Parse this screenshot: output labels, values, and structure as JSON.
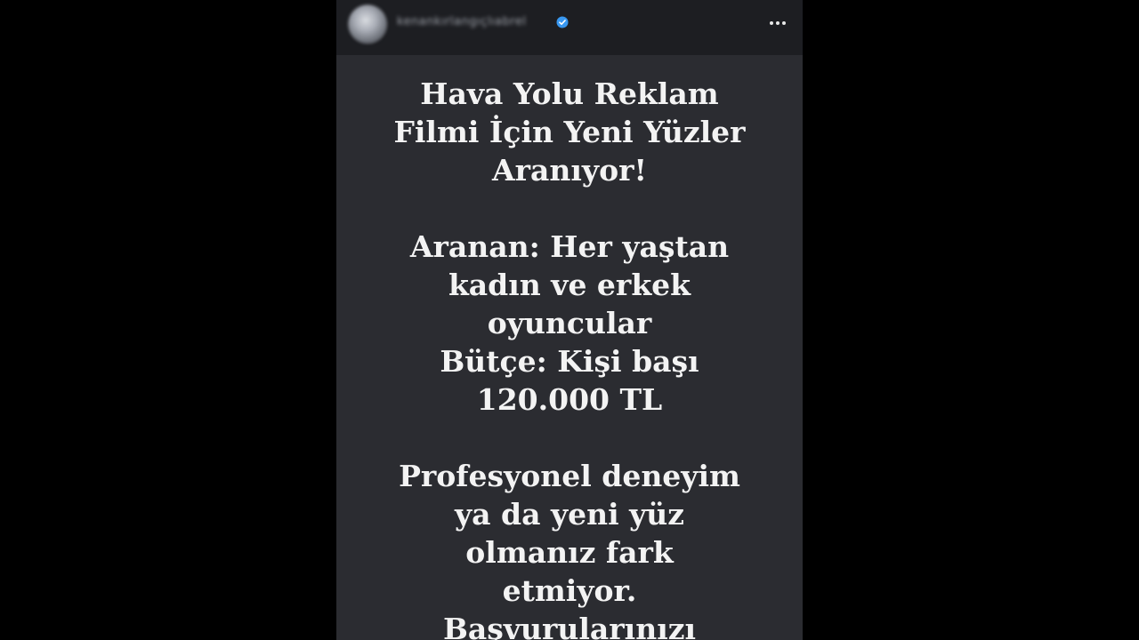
{
  "story": {
    "username": "kenankırlangıçlıabrel",
    "icons": {
      "verified": "verified-badge-icon",
      "more": "more-options-icon"
    },
    "colors": {
      "background": "#2b2c31",
      "header": "#1d1e22",
      "text": "#f3f3f3",
      "verified": "#3897f0"
    },
    "text_blocks": [
      {
        "lines": [
          "Hava Yolu Reklam",
          "Filmi İçin Yeni Yüzler",
          "Aranıyor!"
        ]
      },
      {
        "lines": [
          "Aranan: Her yaştan",
          "kadın ve erkek",
          "oyuncular",
          "Bütçe: Kişi başı",
          "120.000 TL"
        ]
      },
      {
        "lines": [
          "Profesyonel deneyim",
          "ya da yeni yüz",
          "olmanız fark",
          "etmiyor.",
          "Başvurularınızı"
        ]
      }
    ]
  }
}
